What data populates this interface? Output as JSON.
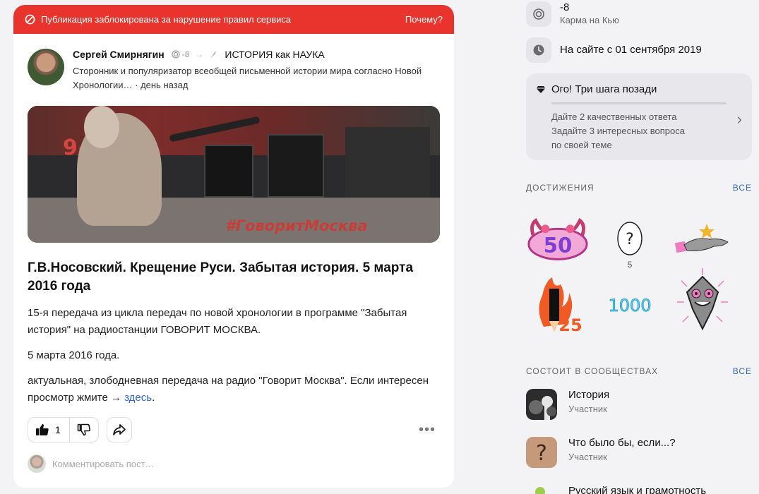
{
  "post": {
    "blocked_text": "Публикация заблокирована за нарушение правил сервиса",
    "why_link": "Почему?",
    "author_name": "Сергей Смирнягин",
    "author_karma": "-8",
    "community_name": "ИСТОРИЯ как НАУКА",
    "author_description": "Сторонник и популяризатор всеобщей письменной истории мира согласно Новой Хронологии…",
    "timestamp": "день назад",
    "preview_sign": "94.8 fm",
    "preview_banner": "#ГоворитМосква",
    "title": "Г.В.Носовский. Крещение Руси. Забытая история. 5 марта 2016 года",
    "body_p1": "15-я передача из цикла передач по новой хронологии в программе \"Забытая история\" на радиостанции ГОВОРИТ МОСКВА.",
    "body_p2": "5 марта 2016 года.",
    "body_p3": "актуальная, злободневная передача на радио \"Говорит Москва\". Если интересен просмотр жмите → ",
    "body_link": "здесь",
    "body_dot": ".",
    "like_count": "1",
    "comment_placeholder": "Комментировать пост…"
  },
  "profile": {
    "karma_value": "-8",
    "karma_label": "Карма на Кью",
    "since_text": "На сайте с 01 сентября 2019"
  },
  "tip": {
    "title": "Ого! Три шага позади",
    "line1": "Дайте 2 качественных ответа",
    "line2": "Задайте 3 интересных вопроса",
    "line3": "по своей теме"
  },
  "achievements": {
    "heading": "ДОСТИЖЕНИЯ",
    "all_label": "ВСЕ",
    "badge_50": "50",
    "badge_egg_count": "5",
    "badge_25": "25",
    "badge_1000": "1000"
  },
  "communities": {
    "heading": "СОСТОИТ В СООБЩЕСТВАХ",
    "all_label": "ВСЕ",
    "items": [
      {
        "name": "История",
        "role": "Участник"
      },
      {
        "name": "Что было бы, если...?",
        "role": "Участник"
      },
      {
        "name": "Русский язык и грамотность"
      }
    ]
  },
  "colors": {
    "blocked_bg": "#e8342c",
    "link": "#3368c8"
  }
}
